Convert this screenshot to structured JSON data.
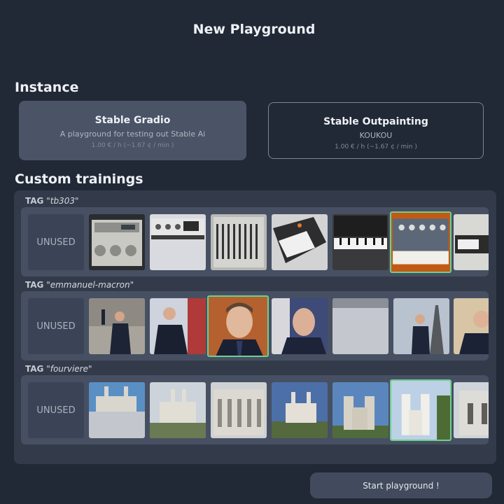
{
  "header": {
    "title": "New Playground"
  },
  "instance": {
    "section_title": "Instance",
    "cards": [
      {
        "name": "Stable Gradio",
        "description": "A playground for testing out Stable Ai",
        "price": "1.00 € / h (~1.67 ¢ / min )",
        "selected": true
      },
      {
        "name": "Stable Outpainting",
        "description": "KOUKOU",
        "price": "1.00 € / h (~1.67 ¢ / min )",
        "selected": false
      }
    ]
  },
  "trainings": {
    "section_title": "Custom trainings",
    "tag_keyword": "TAG",
    "unused_label": "UNUSED",
    "rows": [
      {
        "tag": "\"tb303\"",
        "selected_image": 6,
        "image_count": 8,
        "image_subject": "synthesizer"
      },
      {
        "tag": "\"emmanuel-macron\"",
        "selected_image": 3,
        "image_count": 8,
        "image_subject": "person"
      },
      {
        "tag": "\"fourviere\"",
        "selected_image": 6,
        "image_count": 8,
        "image_subject": "basilica"
      }
    ]
  },
  "footer": {
    "start_label": "Start playground !"
  }
}
